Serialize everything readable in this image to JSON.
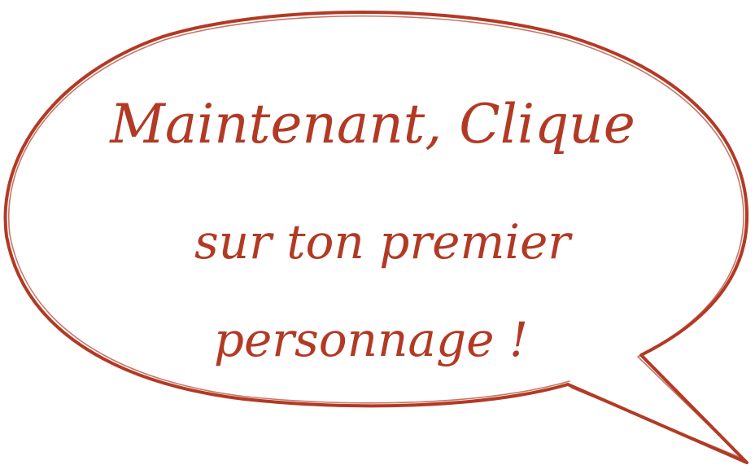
{
  "colors": {
    "accent": "#b23a25",
    "background": "#ffffff"
  },
  "bubble": {
    "line1": "Maintenant, Clique",
    "line2": "sur ton premier",
    "line3": "personnage !"
  }
}
